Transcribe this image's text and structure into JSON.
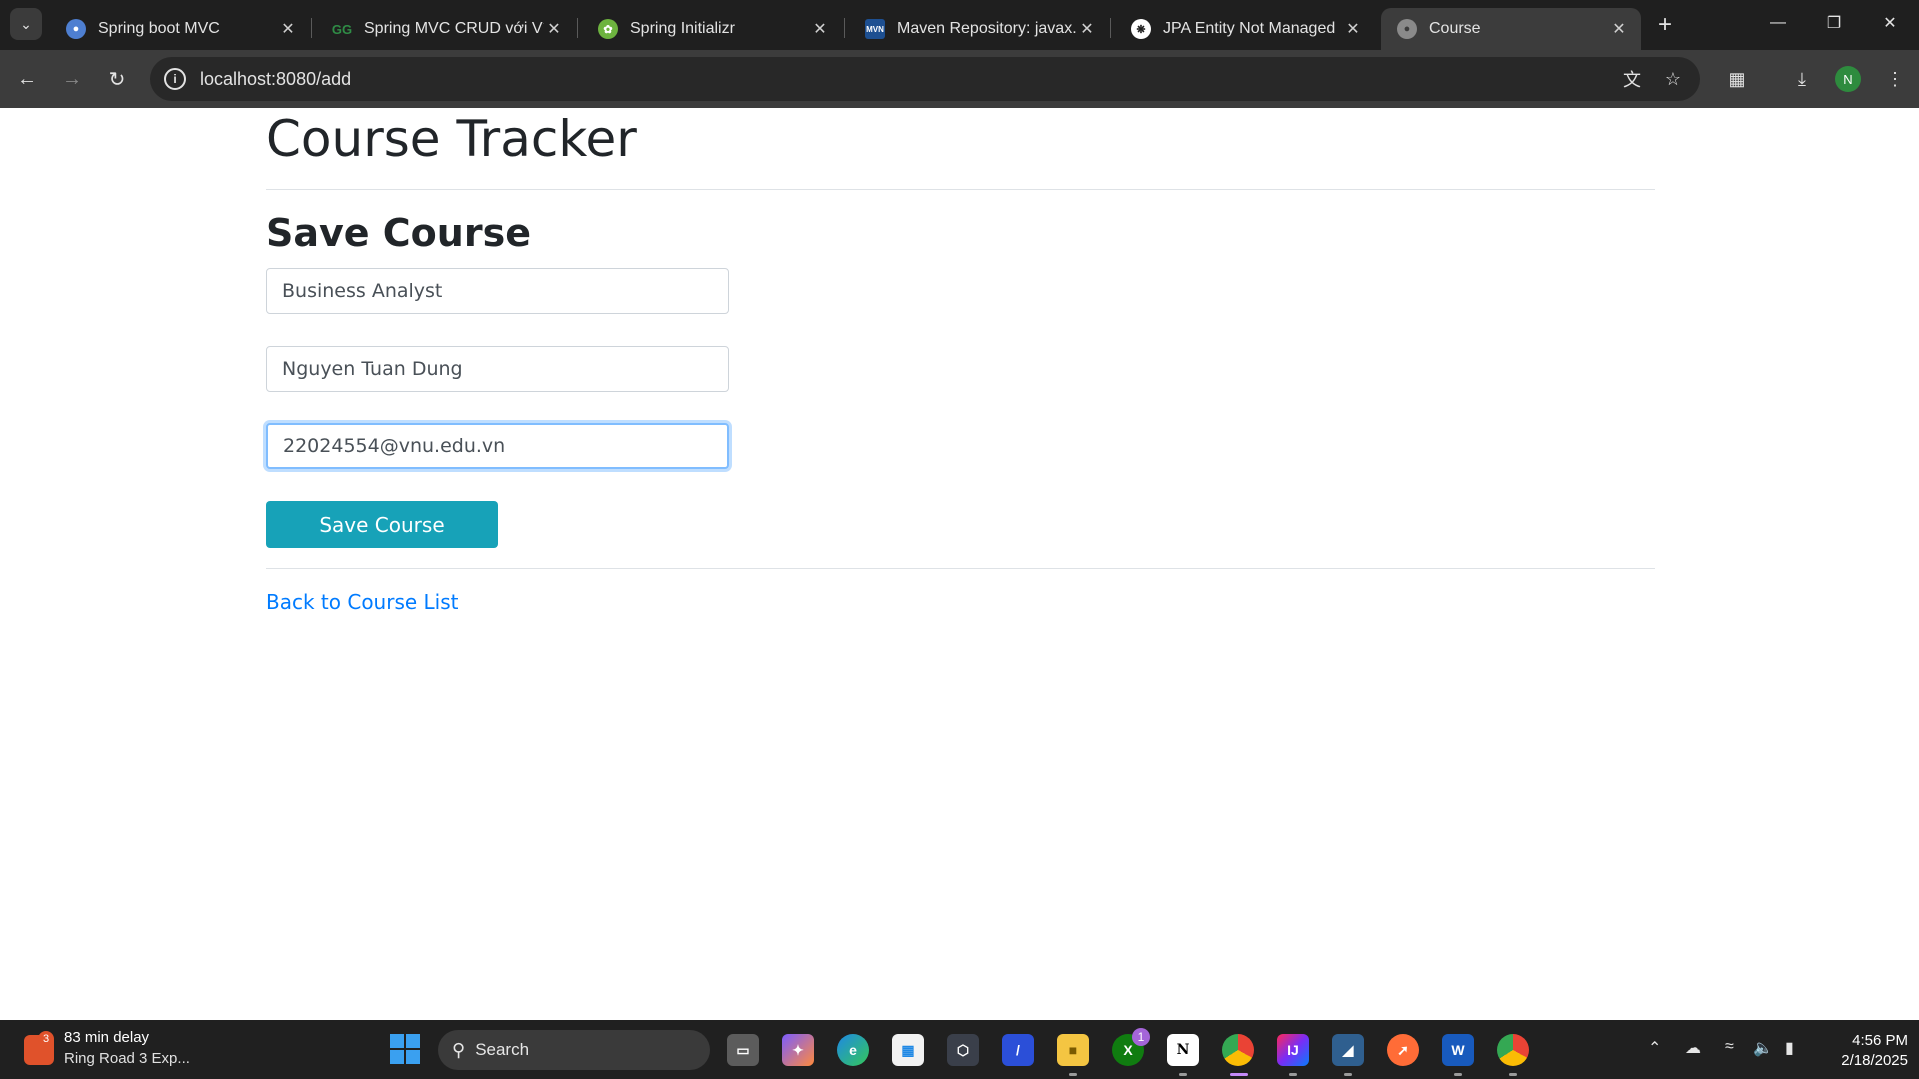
{
  "browser": {
    "tabs": [
      {
        "title": "Spring boot MVC",
        "icon": "tab-favicon-globe-blue",
        "active": false
      },
      {
        "title": "Spring MVC CRUD với Ví dụ",
        "icon": "tab-favicon-gfg",
        "active": false
      },
      {
        "title": "Spring Initializr",
        "icon": "tab-favicon-spring",
        "active": false
      },
      {
        "title": "Maven Repository: javax.pe",
        "icon": "tab-favicon-mvn",
        "active": false
      },
      {
        "title": "JPA Entity Not Managed",
        "icon": "tab-favicon-openai",
        "active": false
      },
      {
        "title": "Course",
        "icon": "tab-favicon-globe",
        "active": true
      }
    ],
    "url": "localhost:8080/add",
    "profile_initial": "N"
  },
  "page": {
    "title": "Course Tracker",
    "heading": "Save Course",
    "fields": {
      "course_name": "Business Analyst",
      "instructor": "Nguyen Tuan Dung",
      "email": "22024554@vnu.edu.vn"
    },
    "save_button": "Save Course",
    "back_link": "Back to Course List"
  },
  "taskbar": {
    "weather_badge": "3",
    "weather_line1": "83 min delay",
    "weather_line2": "Ring Road 3 Exp...",
    "search_label": "Search",
    "xbox_badge": "1",
    "time": "4:56 PM",
    "date": "2/18/2025"
  },
  "colors": {
    "accent_button": "#17a2b8",
    "link": "#007bff",
    "focus_ring": "#80bdff"
  }
}
